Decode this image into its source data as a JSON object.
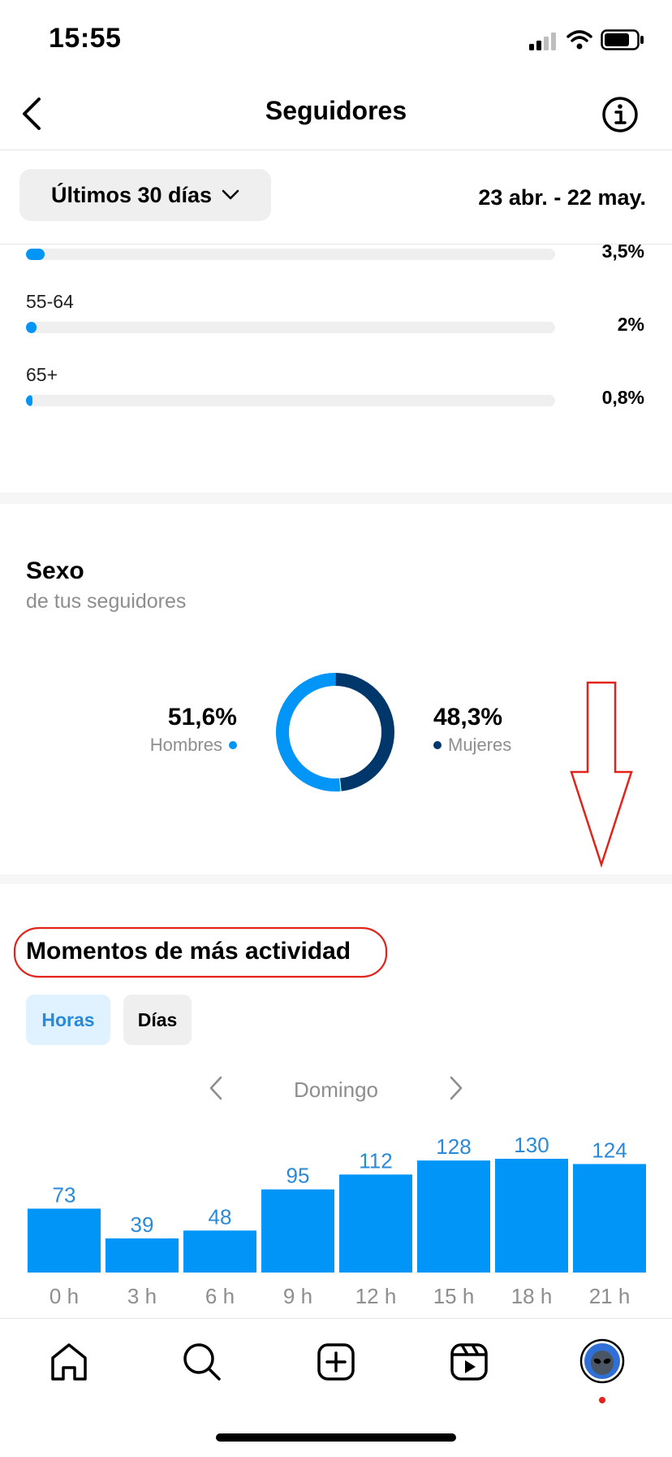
{
  "status": {
    "time": "15:55"
  },
  "header": {
    "title": "Seguidores"
  },
  "filter": {
    "period_label": "Últimos 30 días",
    "date_range": "23 abr. - 22 may."
  },
  "age": {
    "rows": [
      {
        "label": "",
        "percent_text": "3,5%",
        "fraction": 0.035
      },
      {
        "label": "55-64",
        "percent_text": "2%",
        "fraction": 0.02
      },
      {
        "label": "65+",
        "percent_text": "0,8%",
        "fraction": 0.008
      }
    ]
  },
  "gender": {
    "title": "Sexo",
    "subtitle": "de tus seguidores",
    "men": {
      "value": "51,6%",
      "label": "Hombres",
      "fraction": 0.516
    },
    "women": {
      "value": "48,3%",
      "label": "Mujeres",
      "fraction": 0.483
    },
    "colors": {
      "men": "#0095f6",
      "women": "#00376b"
    }
  },
  "activity": {
    "title": "Momentos de más actividad",
    "tabs": [
      {
        "label": "Horas",
        "active": true
      },
      {
        "label": "Días",
        "active": false
      }
    ],
    "day": "Domingo"
  },
  "chart_data": {
    "type": "bar",
    "categories": [
      "0 h",
      "3 h",
      "6 h",
      "9 h",
      "12 h",
      "15 h",
      "18 h",
      "21 h"
    ],
    "values": [
      73,
      39,
      48,
      95,
      112,
      128,
      130,
      124
    ],
    "ylim": [
      0,
      130
    ],
    "bar_color": "#0095f6",
    "label_color": "#2a8ad9"
  },
  "tabbar": {
    "icons": [
      "home-icon",
      "search-icon",
      "create-icon",
      "reels-icon",
      "profile-avatar"
    ]
  },
  "colors": {
    "accent": "#0095f6",
    "annotation": "#e2231a"
  }
}
